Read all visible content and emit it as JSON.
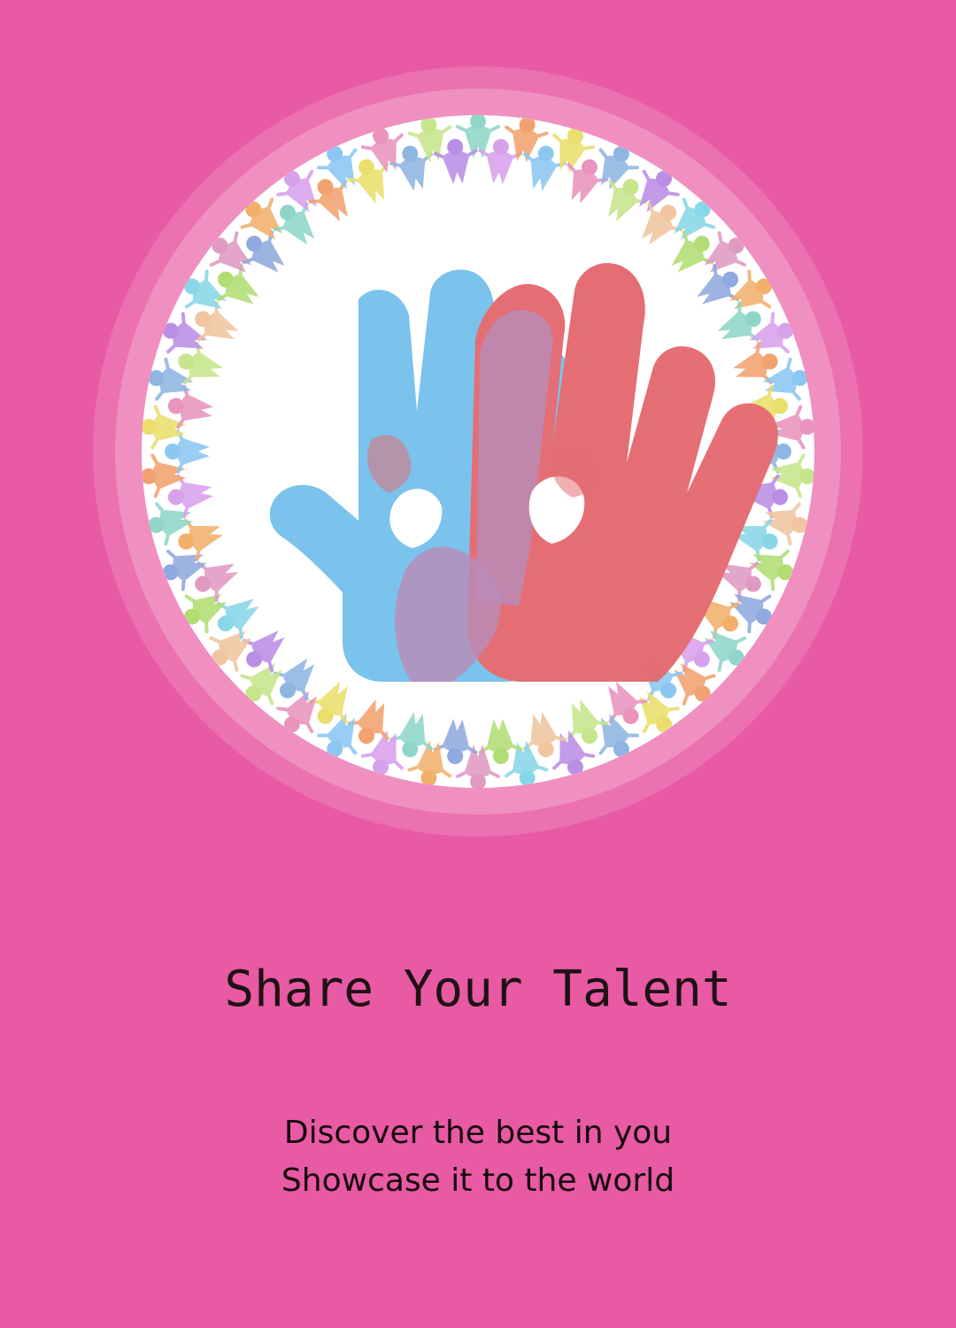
{
  "hero": {
    "title": "Share Your Talent",
    "subtitle_line_1": "Discover the best in you",
    "subtitle_line_2": "Showcase it to the world"
  },
  "colors": {
    "background": "#e85aa4",
    "blue_hand": "#78c2ec",
    "red_hand": "#e46c72",
    "overlap": "#b88ab8"
  },
  "icons": {
    "logo": "handprint-logo-icon"
  }
}
